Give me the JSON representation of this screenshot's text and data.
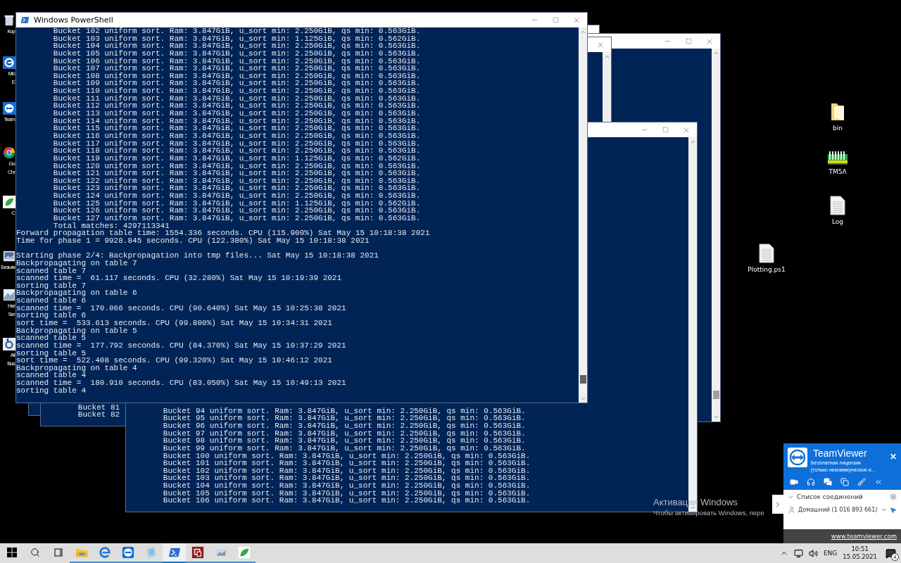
{
  "desktop_icons_left": [
    {
      "kind": "recycle-bin",
      "label_lines": [
        "Кор"
      ]
    },
    {
      "kind": "edge",
      "label_lines": [
        "Mic",
        "E"
      ]
    },
    {
      "kind": "teamviewer",
      "label_lines": [
        "Team"
      ]
    },
    {
      "kind": "chrome",
      "label_lines": [
        "Go",
        "Chr"
      ]
    },
    {
      "kind": "leaf",
      "label_lines": [
        "C"
      ]
    },
    {
      "kind": "image",
      "label_lines": [
        "Безым"
      ]
    },
    {
      "kind": "screenshot",
      "label_lines": [
        "Har",
        "Ser"
      ]
    },
    {
      "kind": "number",
      "label_lines": [
        "All",
        "Bus"
      ]
    }
  ],
  "desktop_icons_right": [
    {
      "kind": "folder",
      "label": "bin"
    },
    {
      "kind": "ram",
      "label": "TM5A"
    },
    {
      "kind": "document",
      "label": "Log"
    },
    {
      "kind": "document",
      "label": "Plotting.ps1"
    }
  ],
  "main_window": {
    "title": "Windows PowerShell",
    "lines": [
      {
        "text": "Bucket 102 uniform sort. Ram: 3.847GiB, u_sort min: 2.250GiB, qs min: 0.563GiB.",
        "indent": true,
        "gap_before": false
      },
      {
        "text": "Bucket 103 uniform sort. Ram: 3.847GiB, u_sort min: 1.125GiB, qs min: 0.562GiB.",
        "indent": true,
        "gap_before": false
      },
      {
        "text": "Bucket 104 uniform sort. Ram: 3.847GiB, u_sort min: 2.250GiB, qs min: 0.563GiB.",
        "indent": true,
        "gap_before": false
      },
      {
        "text": "Bucket 105 uniform sort. Ram: 3.847GiB, u_sort min: 2.250GiB, qs min: 0.563GiB.",
        "indent": true,
        "gap_before": false
      },
      {
        "text": "Bucket 106 uniform sort. Ram: 3.847GiB, u_sort min: 2.250GiB, qs min: 0.563GiB.",
        "indent": true,
        "gap_before": false
      },
      {
        "text": "Bucket 107 uniform sort. Ram: 3.847GiB, u_sort min: 2.250GiB, qs min: 0.563GiB.",
        "indent": true,
        "gap_before": false
      },
      {
        "text": "Bucket 108 uniform sort. Ram: 3.847GiB, u_sort min: 2.250GiB, qs min: 0.563GiB.",
        "indent": true,
        "gap_before": false
      },
      {
        "text": "Bucket 109 uniform sort. Ram: 3.847GiB, u_sort min: 2.250GiB, qs min: 0.563GiB.",
        "indent": true,
        "gap_before": false
      },
      {
        "text": "Bucket 110 uniform sort. Ram: 3.847GiB, u_sort min: 2.250GiB, qs min: 0.563GiB.",
        "indent": true,
        "gap_before": false
      },
      {
        "text": "Bucket 111 uniform sort. Ram: 3.847GiB, u_sort min: 2.250GiB, qs min: 0.563GiB.",
        "indent": true,
        "gap_before": false
      },
      {
        "text": "Bucket 112 uniform sort. Ram: 3.847GiB, u_sort min: 2.250GiB, qs min: 0.563GiB.",
        "indent": true,
        "gap_before": false
      },
      {
        "text": "Bucket 113 uniform sort. Ram: 3.847GiB, u_sort min: 2.250GiB, qs min: 0.563GiB.",
        "indent": true,
        "gap_before": false
      },
      {
        "text": "Bucket 114 uniform sort. Ram: 3.847GiB, u_sort min: 2.250GiB, qs min: 0.563GiB.",
        "indent": true,
        "gap_before": false
      },
      {
        "text": "Bucket 115 uniform sort. Ram: 3.847GiB, u_sort min: 2.250GiB, qs min: 0.563GiB.",
        "indent": true,
        "gap_before": false
      },
      {
        "text": "Bucket 116 uniform sort. Ram: 3.847GiB, u_sort min: 2.250GiB, qs min: 0.563GiB.",
        "indent": true,
        "gap_before": false
      },
      {
        "text": "Bucket 117 uniform sort. Ram: 3.847GiB, u_sort min: 2.250GiB, qs min: 0.563GiB.",
        "indent": true,
        "gap_before": false
      },
      {
        "text": "Bucket 118 uniform sort. Ram: 3.847GiB, u_sort min: 2.250GiB, qs min: 0.563GiB.",
        "indent": true,
        "gap_before": false
      },
      {
        "text": "Bucket 119 uniform sort. Ram: 3.847GiB, u_sort min: 1.125GiB, qs min: 0.562GiB.",
        "indent": true,
        "gap_before": false
      },
      {
        "text": "Bucket 120 uniform sort. Ram: 3.847GiB, u_sort min: 2.250GiB, qs min: 0.563GiB.",
        "indent": true,
        "gap_before": false
      },
      {
        "text": "Bucket 121 uniform sort. Ram: 3.847GiB, u_sort min: 2.250GiB, qs min: 0.563GiB.",
        "indent": true,
        "gap_before": false
      },
      {
        "text": "Bucket 122 uniform sort. Ram: 3.847GiB, u_sort min: 2.250GiB, qs min: 0.563GiB.",
        "indent": true,
        "gap_before": false
      },
      {
        "text": "Bucket 123 uniform sort. Ram: 3.847GiB, u_sort min: 2.250GiB, qs min: 0.563GiB.",
        "indent": true,
        "gap_before": false
      },
      {
        "text": "Bucket 124 uniform sort. Ram: 3.847GiB, u_sort min: 2.250GiB, qs min: 0.563GiB.",
        "indent": true,
        "gap_before": false
      },
      {
        "text": "Bucket 125 uniform sort. Ram: 3.847GiB, u_sort min: 1.125GiB, qs min: 0.562GiB.",
        "indent": true,
        "gap_before": false
      },
      {
        "text": "Bucket 126 uniform sort. Ram: 3.847GiB, u_sort min: 2.250GiB, qs min: 0.563GiB.",
        "indent": true,
        "gap_before": false
      },
      {
        "text": "Bucket 127 uniform sort. Ram: 3.847GiB, u_sort min: 2.250GiB, qs min: 0.563GiB.",
        "indent": true,
        "gap_before": false
      },
      {
        "text": "Total matches: 4297113341",
        "indent": true,
        "gap_before": false
      },
      {
        "text": "Forward propagation table time: 1554.336 seconds. CPU (115.900%) Sat May 15 10:18:38 2021",
        "indent": false,
        "gap_before": false
      },
      {
        "text": "Time for phase 1 = 9928.845 seconds. CPU (122.380%) Sat May 15 10:18:38 2021",
        "indent": false,
        "gap_before": false
      },
      {
        "text": "Starting phase 2/4: Backpropagation into tmp files... Sat May 15 10:18:38 2021",
        "indent": false,
        "gap_before": true
      },
      {
        "text": "Backpropagating on table 7",
        "indent": false,
        "gap_before": false
      },
      {
        "text": "scanned table 7",
        "indent": false,
        "gap_before": false
      },
      {
        "text": "scanned time =  61.117 seconds. CPU (32.280%) Sat May 15 10:19:39 2021",
        "indent": false,
        "gap_before": false
      },
      {
        "text": "sorting table 7",
        "indent": false,
        "gap_before": false
      },
      {
        "text": "Backpropagating on table 6",
        "indent": false,
        "gap_before": false
      },
      {
        "text": "scanned table 6",
        "indent": false,
        "gap_before": false
      },
      {
        "text": "scanned time =  170.066 seconds. CPU (90.640%) Sat May 15 10:25:38 2021",
        "indent": false,
        "gap_before": false
      },
      {
        "text": "sorting table 6",
        "indent": false,
        "gap_before": false
      },
      {
        "text": "sort time =  533.613 seconds. CPU (99.800%) Sat May 15 10:34:31 2021",
        "indent": false,
        "gap_before": false
      },
      {
        "text": "Backpropagating on table 5",
        "indent": false,
        "gap_before": false
      },
      {
        "text": "scanned table 5",
        "indent": false,
        "gap_before": false
      },
      {
        "text": "scanned time =  177.792 seconds. CPU (84.370%) Sat May 15 10:37:29 2021",
        "indent": false,
        "gap_before": false
      },
      {
        "text": "sorting table 5",
        "indent": false,
        "gap_before": false
      },
      {
        "text": "sort time =  522.408 seconds. CPU (99.320%) Sat May 15 10:46:12 2021",
        "indent": false,
        "gap_before": false
      },
      {
        "text": "Backpropagating on table 4",
        "indent": false,
        "gap_before": false
      },
      {
        "text": "scanned table 4",
        "indent": false,
        "gap_before": false
      },
      {
        "text": "scanned time =  180.910 seconds. CPU (83.050%) Sat May 15 10:49:13 2021",
        "indent": false,
        "gap_before": false
      },
      {
        "text": "sorting table 4",
        "indent": false,
        "gap_before": false
      }
    ]
  },
  "left_back_window": {
    "lines": [
      {
        "text": "Bucket 81",
        "indent": true,
        "gap_before": false
      },
      {
        "text": "Bucket 82",
        "indent": true,
        "gap_before": false
      }
    ]
  },
  "bottom_back_window": {
    "lines": [
      {
        "text": "Bucket 94 uniform sort. Ram: 3.847GiB, u_sort min: 2.250GiB, qs min: 0.563GiB.",
        "indent": true,
        "gap_before": false
      },
      {
        "text": "Bucket 95 uniform sort. Ram: 3.847GiB, u_sort min: 2.250GiB, qs min: 0.563GiB.",
        "indent": true,
        "gap_before": false
      },
      {
        "text": "Bucket 96 uniform sort. Ram: 3.847GiB, u_sort min: 2.250GiB, qs min: 0.563GiB.",
        "indent": true,
        "gap_before": false
      },
      {
        "text": "Bucket 97 uniform sort. Ram: 3.847GiB, u_sort min: 2.250GiB, qs min: 0.563GiB.",
        "indent": true,
        "gap_before": false
      },
      {
        "text": "Bucket 98 uniform sort. Ram: 3.847GiB, u_sort min: 2.250GiB, qs min: 0.563GiB.",
        "indent": true,
        "gap_before": false
      },
      {
        "text": "Bucket 99 uniform sort. Ram: 3.847GiB, u_sort min: 2.250GiB, qs min: 0.563GiB.",
        "indent": true,
        "gap_before": false
      },
      {
        "text": "Bucket 100 uniform sort. Ram: 3.847GiB, u_sort min: 2.250GiB, qs min: 0.563GiB.",
        "indent": true,
        "gap_before": false
      },
      {
        "text": "Bucket 101 uniform sort. Ram: 3.847GiB, u_sort min: 2.250GiB, qs min: 0.563GiB.",
        "indent": true,
        "gap_before": false
      },
      {
        "text": "Bucket 102 uniform sort. Ram: 3.847GiB, u_sort min: 2.250GiB, qs min: 0.563GiB.",
        "indent": true,
        "gap_before": false
      },
      {
        "text": "Bucket 103 uniform sort. Ram: 3.847GiB, u_sort min: 2.250GiB, qs min: 0.563GiB.",
        "indent": true,
        "gap_before": false
      },
      {
        "text": "Bucket 104 uniform sort. Ram: 3.847GiB, u_sort min: 2.250GiB, qs min: 0.563GiB.",
        "indent": true,
        "gap_before": false
      },
      {
        "text": "Bucket 105 uniform sort. Ram: 3.847GiB, u_sort min: 2.250GiB, qs min: 0.563GiB.",
        "indent": true,
        "gap_before": false
      },
      {
        "text": "Bucket 106 uniform sort. Ram: 3.847GiB, u_sort min: 2.250GiB, qs min: 0.563GiB.",
        "indent": true,
        "gap_before": false
      }
    ]
  },
  "activation": {
    "title": "Активация Windows",
    "text": "Чтобы активировать Windows, пере"
  },
  "teamviewer": {
    "brand": "**Team**Viewer",
    "license_lines": [
      "Бесплатная лицензия",
      "(только некоммерческое и..."
    ],
    "close": "✕",
    "connections_title": "Список соединений",
    "connections_expanded": true,
    "contact": "Домашний (1 016 893 661)",
    "link": "www.teamviewer.com"
  },
  "taskbar": {
    "apps": [
      {
        "kind": "explorer",
        "running": true,
        "selected": false
      },
      {
        "kind": "edge",
        "running": true,
        "selected": false
      },
      {
        "kind": "teamviewer",
        "running": true,
        "selected": false
      },
      {
        "kind": "notepad",
        "running": true,
        "selected": false
      },
      {
        "kind": "powershell",
        "running": true,
        "selected": true
      },
      {
        "kind": "red-app",
        "running": true,
        "selected": false
      },
      {
        "kind": "image",
        "running": true,
        "selected": false
      },
      {
        "kind": "leaf",
        "running": true,
        "selected": false
      }
    ],
    "language": "ENG",
    "time": "10:51",
    "date": "15.05.2021",
    "notifications": "4"
  }
}
